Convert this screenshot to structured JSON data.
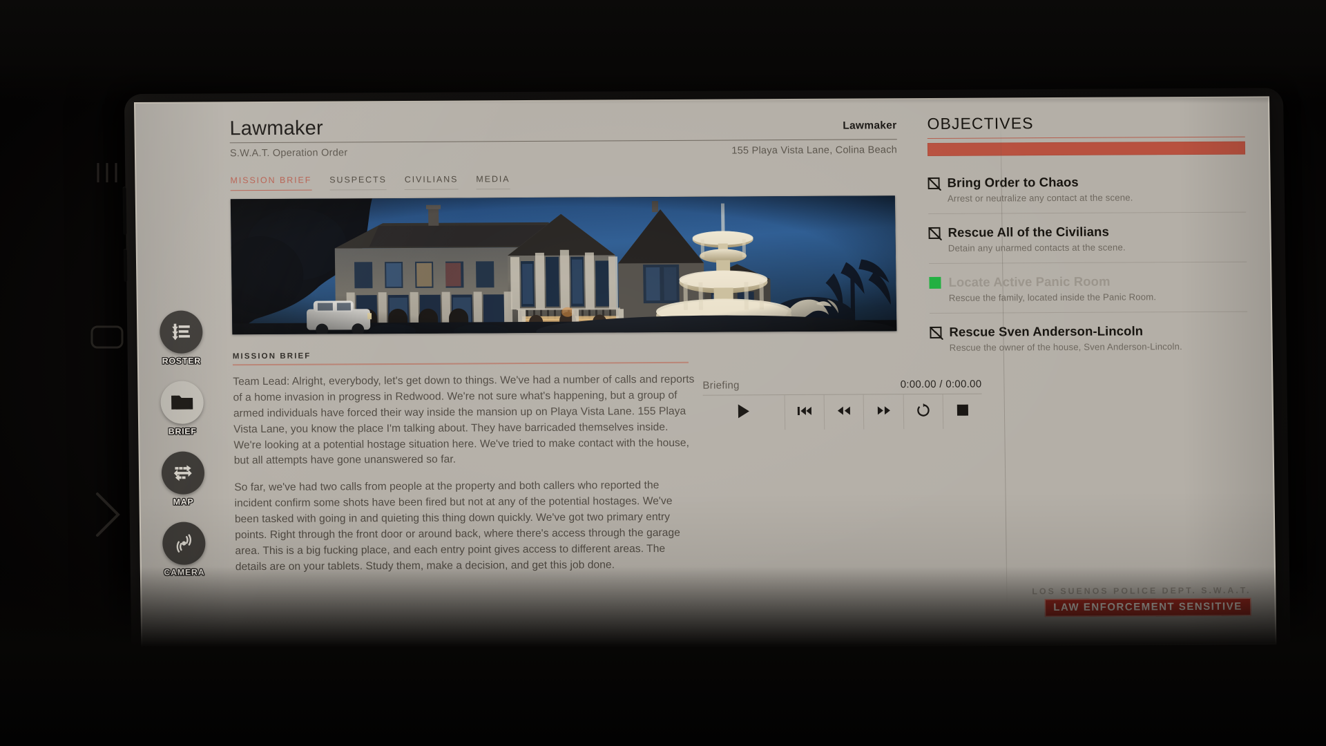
{
  "app": {
    "device": "swat-tablet"
  },
  "nav_rail": {
    "items": [
      {
        "label": "ROSTER",
        "icon": "roster-list-icon",
        "active": false
      },
      {
        "label": "BRIEF",
        "icon": "folder-icon",
        "active": true
      },
      {
        "label": "MAP",
        "icon": "route-map-icon",
        "active": false
      },
      {
        "label": "CAMERA",
        "icon": "camera-wave-icon",
        "active": false
      }
    ]
  },
  "header": {
    "title": "Lawmaker",
    "title_right": "Lawmaker",
    "subtitle": "S.W.A.T. Operation Order",
    "address": "155 Playa Vista Lane, Colina Beach"
  },
  "tabs": [
    {
      "label": "MISSION BRIEF",
      "active": true
    },
    {
      "label": "SUSPECTS",
      "active": false
    },
    {
      "label": "CIVILIANS",
      "active": false
    },
    {
      "label": "MEDIA",
      "active": false
    }
  ],
  "hero": {
    "alt": "Night photo of a large lit mansion with a tiered fountain in the foreground",
    "name": "mansion-night-photo"
  },
  "brief": {
    "kicker": "MISSION BRIEF",
    "paragraphs": [
      "Team Lead: Alright, everybody, let's get down to things. We've had a number of calls and reports of a home invasion in progress in Redwood. We're not sure what's happening, but a group of armed individuals have forced their way inside the mansion up on Playa Vista Lane. 155 Playa Vista Lane, you know the place I'm talking about. They have barricaded themselves inside. We're looking at a potential hostage situation here. We've tried to make contact with the house, but all attempts have gone unanswered so far.",
      "So far, we've had two calls from people at the property and both callers who reported the incident confirm some shots have been fired but not at any of the potential hostages. We've been tasked with going in and quieting this thing down quickly. We've got two primary entry points. Right through the front door or around back, where there's access through the garage area. This is a big fucking place, and each entry point gives access to different areas. The details are on your tablets. Study them, make a decision, and get this job done."
    ]
  },
  "player": {
    "track_label": "Briefing",
    "time": "0:00.00 / 0:00.00",
    "buttons": [
      {
        "name": "play-button",
        "icon": "play-icon"
      },
      {
        "name": "skip-to-start-button",
        "icon": "skip-back-icon"
      },
      {
        "name": "rewind-button",
        "icon": "rewind-icon"
      },
      {
        "name": "fast-forward-button",
        "icon": "fast-forward-icon"
      },
      {
        "name": "loop-button",
        "icon": "loop-icon"
      },
      {
        "name": "stop-button",
        "icon": "stop-icon"
      }
    ]
  },
  "objectives": {
    "title": "OBJECTIVES",
    "progress_percent": 100,
    "items": [
      {
        "name": "Bring Order to Chaos",
        "desc": "Arrest or neutralize any contact at the scene.",
        "state": "pending"
      },
      {
        "name": "Rescue All of the Civilians",
        "desc": "Detain any unarmed contacts at the scene.",
        "state": "pending"
      },
      {
        "name": "Locate Active Panic Room",
        "desc": "Rescue the family, located inside the Panic Room.",
        "state": "complete"
      },
      {
        "name": "Rescue Sven Anderson-Lincoln",
        "desc": "Rescue the owner of the house, Sven Anderson-Lincoln.",
        "state": "pending"
      }
    ]
  },
  "footer": {
    "department": "LOS SUENOS POLICE DEPT. S.W.A.T.",
    "stamp": "LAW ENFORCEMENT SENSITIVE"
  },
  "colors": {
    "accent_red": "#b55d4d",
    "stamp_red": "#ad2b20",
    "bar_red": "#b8513f",
    "complete_green": "#1faf3e",
    "paper": "#b4afa7",
    "ink": "#17140f"
  }
}
